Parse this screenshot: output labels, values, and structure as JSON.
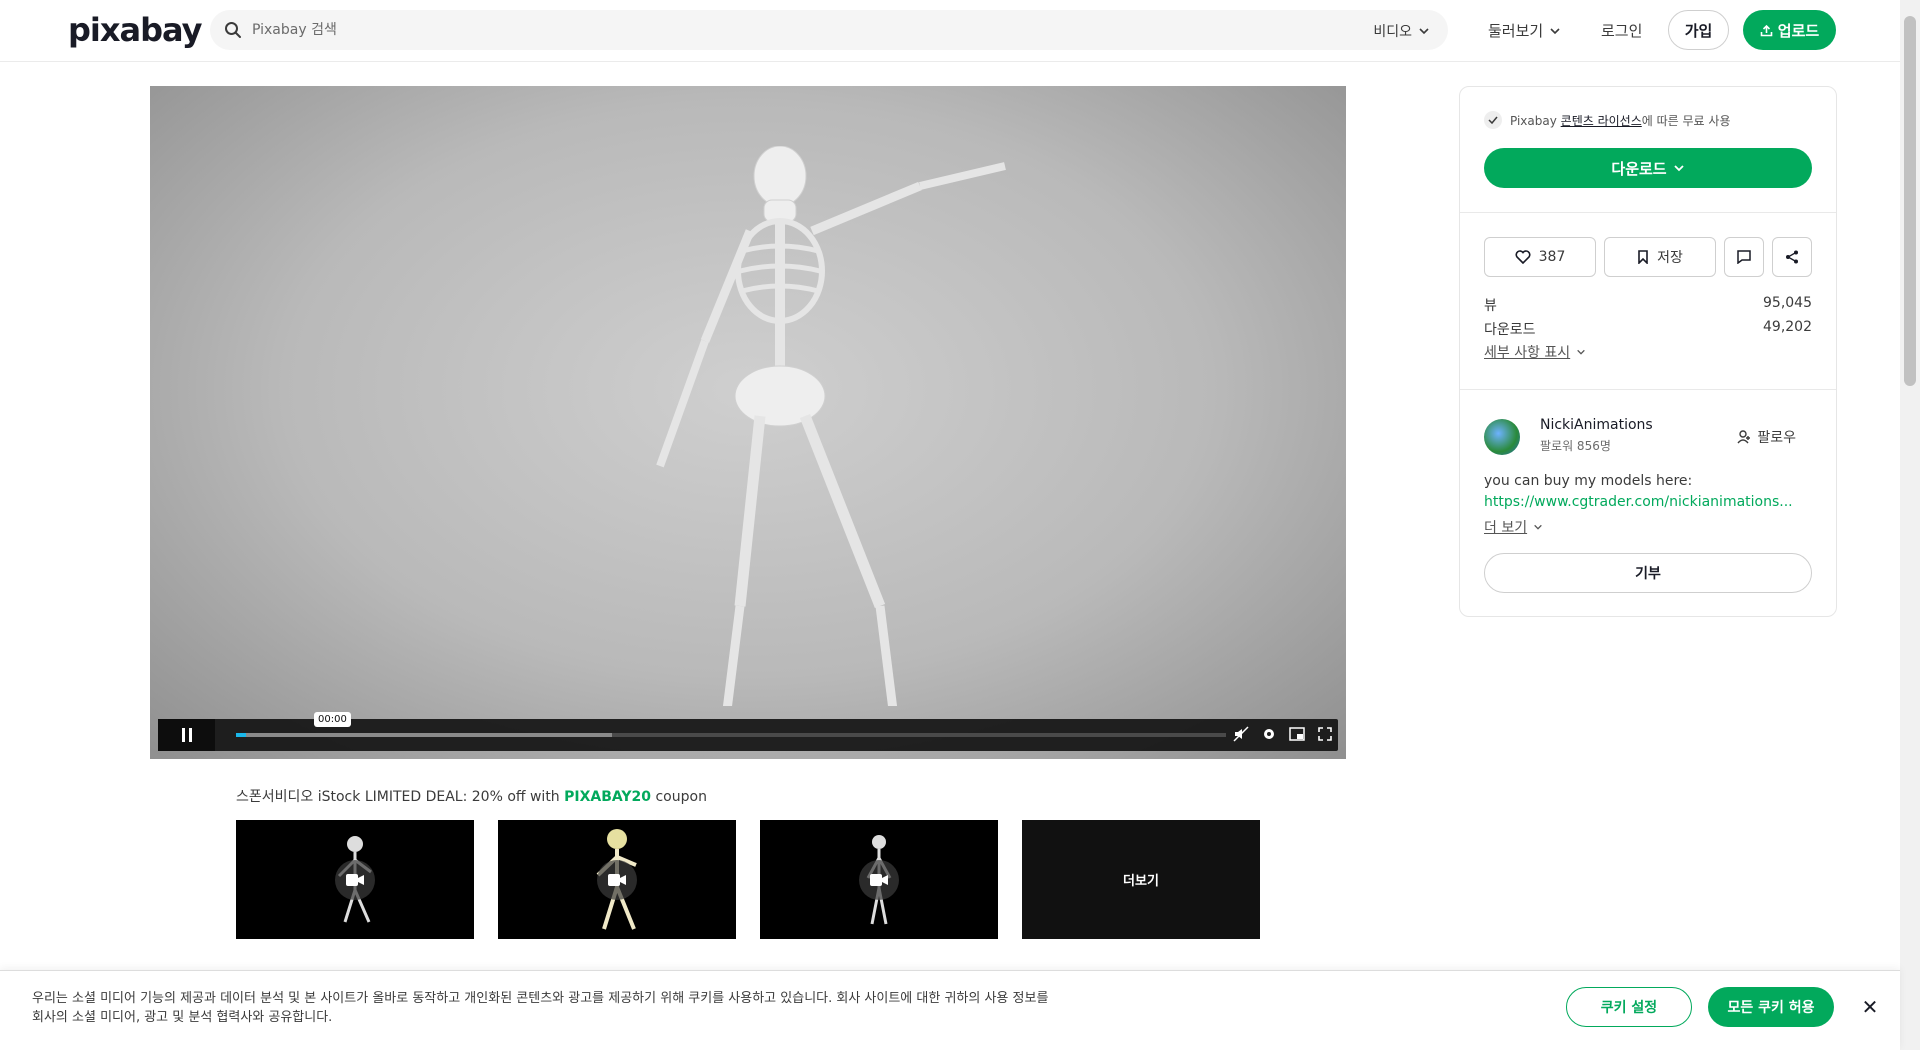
{
  "header": {
    "logo": "pixabay",
    "search_placeholder": "Pixabay 검색",
    "search_type": "비디오",
    "explore": "둘러보기",
    "login": "로그인",
    "join": "가입",
    "upload": "업로드"
  },
  "video": {
    "time": "00:00",
    "played_fraction": 0.01,
    "buffered_fraction": 0.38
  },
  "sponsor": {
    "prefix": "스폰서비디오 iStock LIMITED DEAL: 20% off with ",
    "code": "PIXABAY20",
    "suffix": " coupon",
    "more_label": "더보기"
  },
  "panel": {
    "license_prefix": "Pixabay ",
    "license_link": "콘텐츠 라이선스",
    "license_suffix": "에 따른 무료 사용",
    "download": "다운로드",
    "likes": "387",
    "save": "저장",
    "views_label": "뷰",
    "views_value": "95,045",
    "downloads_label": "다운로드",
    "downloads_value": "49,202",
    "details": "세부 사항 표시",
    "user_name": "NickiAnimations",
    "user_followers": "팔로워 856명",
    "follow": "팔로우",
    "bio": "you can buy my models here:",
    "bio_link": "https://www.cgtrader.com/nickianimations...",
    "more": "더 보기",
    "donate": "기부"
  },
  "cookie": {
    "text": "우리는 소셜 미디어 기능의 제공과 데이터 분석 및 본 사이트가 올바로 동작하고 개인화된 콘텐츠와 광고를 제공하기 위해 쿠키를 사용하고 있습니다. 회사 사이트에 대한 귀하의 사용 정보를 회사의 소셜 미디어, 광고 및 분석 협력사와 공유합니다.",
    "settings": "쿠키 설정",
    "allow_all": "모든 쿠키 허용"
  },
  "colors": {
    "brand": "#02a95c",
    "progress": "#1ab7ea"
  }
}
